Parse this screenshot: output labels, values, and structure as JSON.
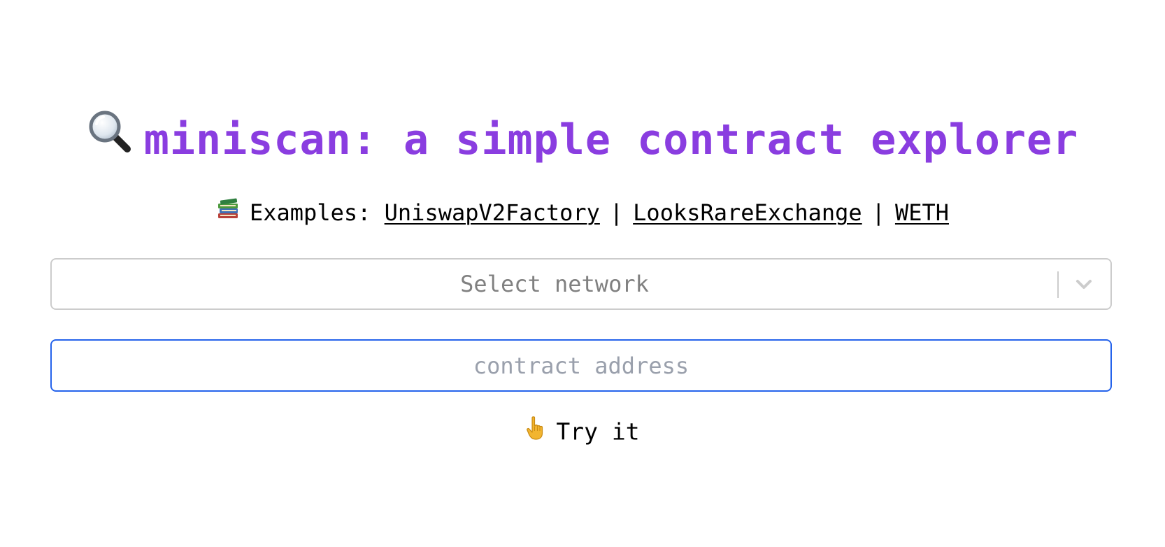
{
  "header": {
    "title": "miniscan: a simple contract explorer",
    "title_icon": "magnifying-glass-icon",
    "title_color": "#8a3de0"
  },
  "examples": {
    "icon": "books-icon",
    "label": "Examples:",
    "links": [
      "UniswapV2Factory",
      "LooksRareExchange",
      "WETH"
    ],
    "separator": "|"
  },
  "network_select": {
    "placeholder": "Select network",
    "icon": "chevron-down-icon"
  },
  "address_input": {
    "placeholder": "contract address",
    "value": "",
    "focus_color": "#2563eb"
  },
  "try_button": {
    "icon": "pointing-hand-icon",
    "label": "Try it"
  }
}
